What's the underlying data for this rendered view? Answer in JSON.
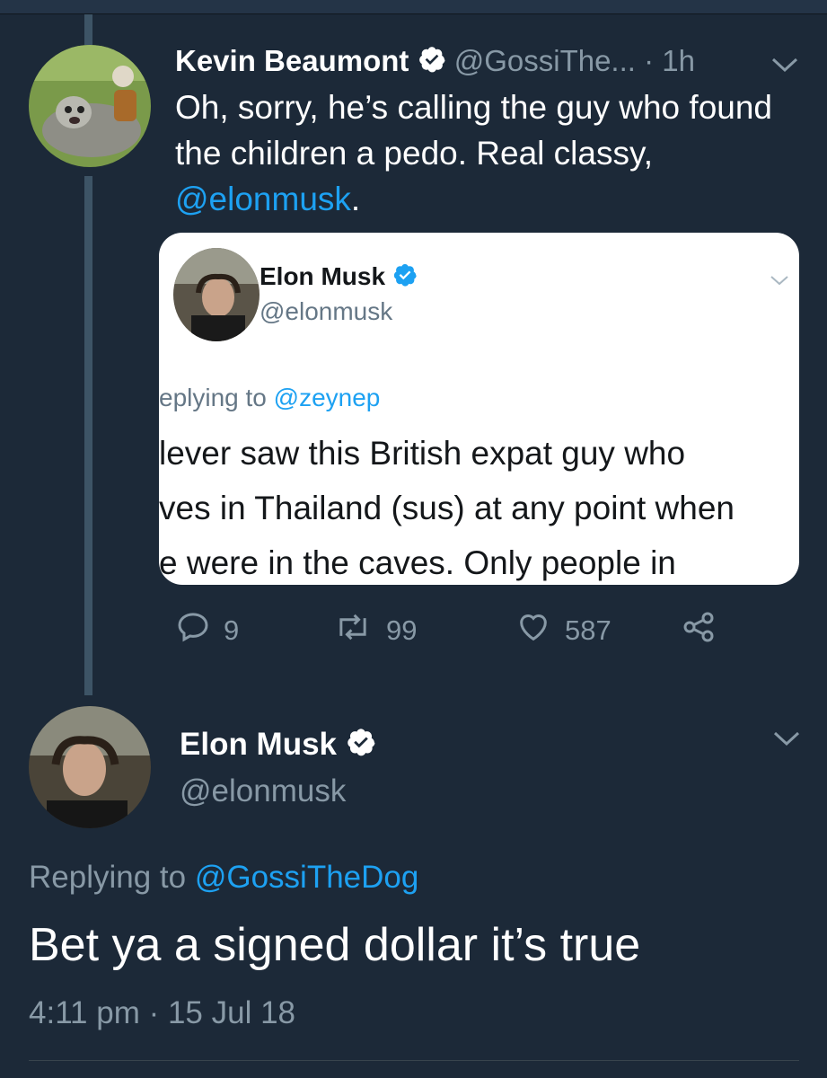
{
  "tweet1": {
    "author_name": "Kevin Beaumont",
    "handle": "@GossiThe...",
    "time": "· 1h",
    "text_line1": "Oh, sorry, he’s calling the guy who found",
    "text_line2": "the children a pedo. Real classy,",
    "mention": "@elonmusk",
    "mention_suffix": ".",
    "actions": {
      "replies": "9",
      "retweets": "99",
      "likes": "587"
    }
  },
  "quoted": {
    "author_name": "Elon Musk",
    "handle": "@elonmusk",
    "replying_prefix": "eplying to ",
    "replying_handle": "@zeynep",
    "line1": "lever saw this British expat guy who",
    "line2": "ves in Thailand (sus) at any point when",
    "line3": "e were in the caves. Only people in"
  },
  "tweet2": {
    "author_name": "Elon Musk",
    "handle": "@elonmusk",
    "replying_prefix": "Replying to ",
    "replying_handle": "@GossiTheDog",
    "text": "Bet ya a signed dollar it’s true",
    "timestamp": "4:11 pm · 15 Jul 18"
  },
  "colors": {
    "background": "#1c2938",
    "link": "#1da1f2",
    "muted": "#8899a6",
    "verified": "#1da1f2"
  }
}
